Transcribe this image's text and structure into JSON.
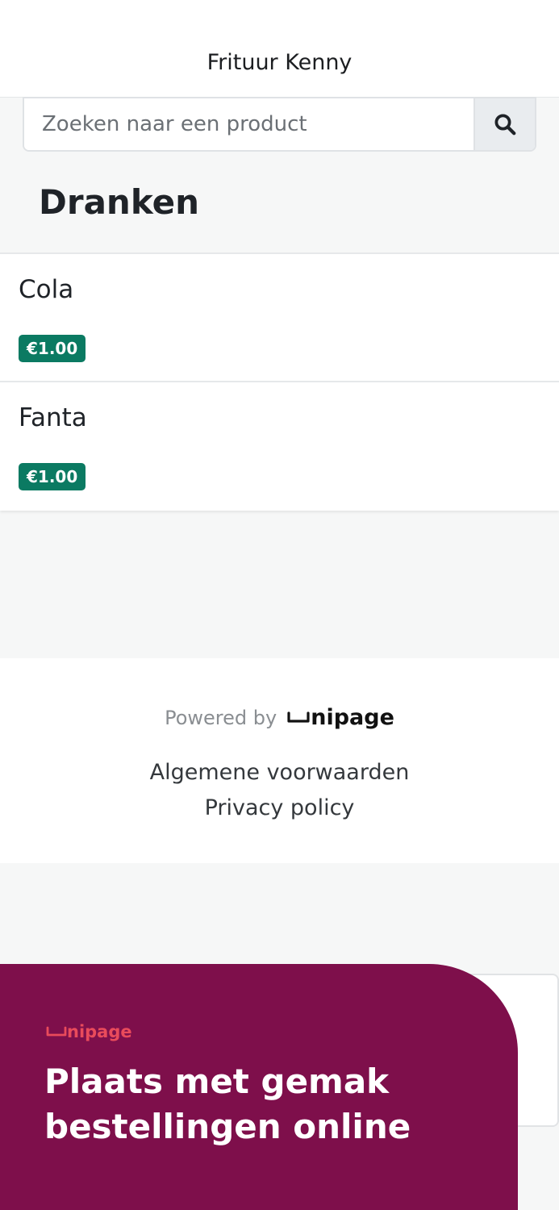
{
  "header": {
    "title": "Frituur Kenny"
  },
  "search": {
    "placeholder": "Zoeken naar een product"
  },
  "category": {
    "title": "Dranken"
  },
  "products": [
    {
      "name": "Cola",
      "price": "€1.00"
    },
    {
      "name": "Fanta",
      "price": "€1.00"
    }
  ],
  "footer": {
    "powered_by": "Powered by",
    "brand": "nipage",
    "terms": "Algemene voorwaarden",
    "privacy": "Privacy policy"
  },
  "promo": {
    "brand": "nipage",
    "headline": "Plaats met gemak bestellingen online"
  },
  "colors": {
    "price_badge": "#0b7a62",
    "promo_background": "#7e0f4b",
    "promo_brand": "#e94b5b"
  },
  "icons": {
    "search": "search-icon",
    "brand_logo": "unipage-logo-icon",
    "ghost": "edit-pencil-icon"
  }
}
